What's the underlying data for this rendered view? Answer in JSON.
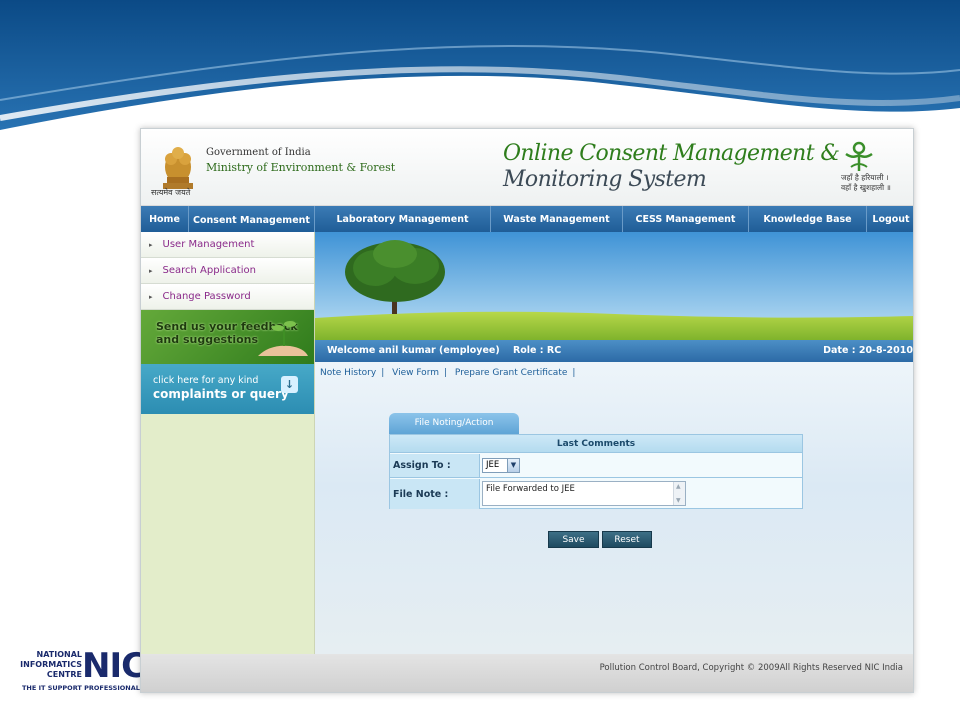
{
  "header": {
    "gov": "Government of India",
    "ministry": "Ministry of Environment & Forest",
    "motto": "सत्यमेव जयते",
    "title_line1": "Online Consent Management &",
    "title_line2": "Monitoring System",
    "slogan_line1": "जहाँ है हरियाली ।",
    "slogan_line2": "वहाँ है खुशहाली ॥"
  },
  "nav": [
    {
      "label": "Home"
    },
    {
      "label": "Consent Management"
    },
    {
      "label": "Laboratory Management"
    },
    {
      "label": "Waste Management"
    },
    {
      "label": "CESS Management"
    },
    {
      "label": "Knowledge Base"
    },
    {
      "label": "Logout"
    }
  ],
  "sidebar": {
    "links": [
      {
        "label": "User Management"
      },
      {
        "label": "Search Application"
      },
      {
        "label": "Change Password"
      }
    ],
    "feedback_line1": "Send us your feedback",
    "feedback_line2": "and suggestions",
    "complaint_small": "click here for any kind",
    "complaint_big": "complaints or query"
  },
  "welcome": {
    "text": "Welcome anil kumar (employee)    Role : RC",
    "date": "Date : 20-8-2010"
  },
  "sublinks": [
    "Note History",
    "View Form",
    "Prepare Grant Certificate"
  ],
  "form": {
    "tab": "File Noting/Action",
    "heading": "Last Comments",
    "assign_label": "Assign To :",
    "assign_value": "JEE",
    "note_label": "File Note :",
    "note_value": "File Forwarded to JEE"
  },
  "buttons": {
    "save": "Save",
    "reset": "Reset"
  },
  "footer": "Pollution Control Board, Copyright © 2009All Rights Reserved NIC India",
  "nic": {
    "line1": "NATIONAL",
    "line2": "INFORMATICS",
    "line3": "CENTRE",
    "big": "NIC",
    "tagline": "THE IT SUPPORT PROFESSIONALS"
  },
  "colors": {
    "nav": "#1f5d97",
    "link": "#8a2a8a",
    "accent_green": "#2e7d1c",
    "button": "#1e4a60"
  }
}
